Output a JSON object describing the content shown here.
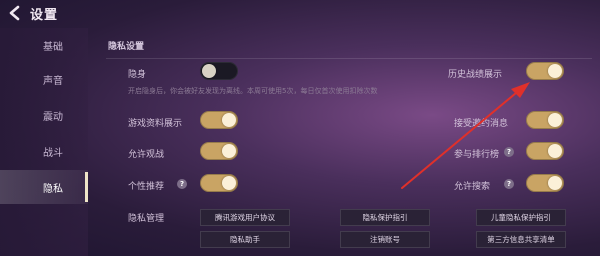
{
  "header": {
    "title": "设置"
  },
  "sidebar": {
    "items": [
      {
        "label": "基础"
      },
      {
        "label": "声音"
      },
      {
        "label": "震动"
      },
      {
        "label": "战斗"
      },
      {
        "label": "隐私",
        "active": true
      }
    ]
  },
  "main": {
    "section_title": "隐私设置",
    "settings": {
      "stealth": {
        "label": "隐身",
        "state": "off",
        "hint": "开启隐身后，你会被好友发现为离线。本周可使用5次，每日仅首次使用扣除次数"
      },
      "history": {
        "label": "历史战绩展示",
        "state": "on"
      },
      "game_info": {
        "label": "游戏资料展示",
        "state": "on"
      },
      "invite_msg": {
        "label": "接受邀约消息",
        "state": "on"
      },
      "allow_spectate": {
        "label": "允许观战",
        "state": "on"
      },
      "leaderboard": {
        "label": "参与排行榜",
        "state": "on",
        "help": "?"
      },
      "personal_rec": {
        "label": "个性推荐",
        "state": "on",
        "help": "?"
      },
      "allow_search": {
        "label": "允许搜索",
        "state": "on",
        "help": "?"
      }
    },
    "privacy_mgmt": {
      "label": "隐私管理",
      "links": [
        "腾讯游戏用户协议",
        "隐私保护指引",
        "儿童隐私保护指引",
        "隐私助手",
        "注销账号",
        "第三方信息共享清单"
      ]
    }
  },
  "colors": {
    "toggle_on": "#c9a464",
    "toggle_off": "#1b1924",
    "arrow": "#e0302a"
  }
}
